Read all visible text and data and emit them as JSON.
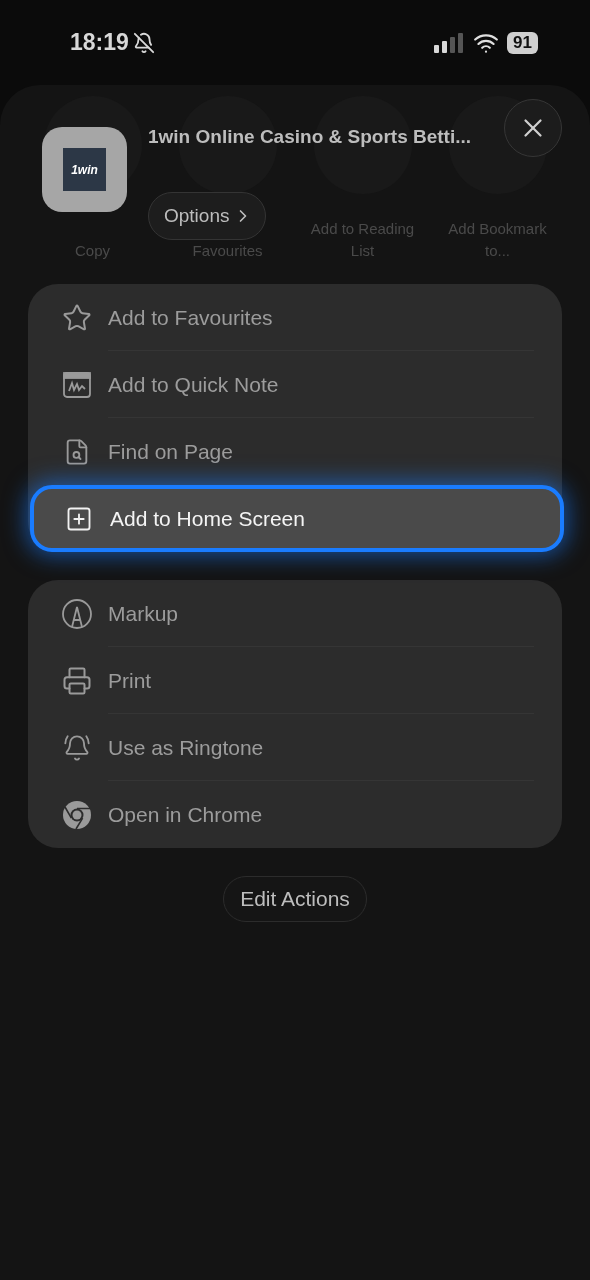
{
  "status_bar": {
    "time": "18:19",
    "silent": true,
    "battery": "91"
  },
  "background_actions": [
    {
      "label": "Copy"
    },
    {
      "label": "Favourites"
    },
    {
      "label": "Add to Reading List"
    },
    {
      "label": "Add Bookmark to..."
    }
  ],
  "header": {
    "logo_text": "1win",
    "title": "1win Online Casino & Sports Betti...",
    "options": "Options"
  },
  "menu_groups": [
    {
      "items": [
        {
          "kind": "star",
          "label": "Add to Favourites",
          "selected": false
        },
        {
          "kind": "note",
          "label": "Add to Quick Note",
          "selected": false
        },
        {
          "kind": "find",
          "label": "Find on Page",
          "selected": false
        },
        {
          "kind": "add",
          "label": "Add to Home Screen",
          "selected": true
        }
      ]
    },
    {
      "items": [
        {
          "kind": "markup",
          "label": "Markup",
          "selected": false
        },
        {
          "kind": "print",
          "label": "Print",
          "selected": false
        },
        {
          "kind": "ringtone",
          "label": "Use as Ringtone",
          "selected": false
        },
        {
          "kind": "browser",
          "label": "Open in Chrome",
          "selected": false
        }
      ]
    }
  ],
  "edit_actions": "Edit Actions"
}
